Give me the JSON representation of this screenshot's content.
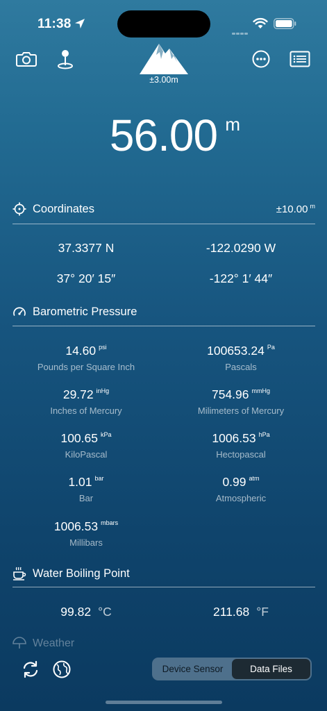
{
  "status": {
    "time": "11:38"
  },
  "header": {
    "accuracy": "±3.00m"
  },
  "altitude": {
    "value": "56.00",
    "unit": "m"
  },
  "coordinates": {
    "title": "Coordinates",
    "accuracy": "±10.00",
    "accuracy_unit": "m",
    "lat_decimal": "37.3377 N",
    "lon_decimal": "-122.0290 W",
    "lat_dms": "37° 20′ 15″",
    "lon_dms": "-122° 1′ 44″"
  },
  "pressure": {
    "title": "Barometric Pressure",
    "items": [
      {
        "value": "14.60",
        "unit": "psi",
        "label": "Pounds per Square Inch"
      },
      {
        "value": "100653.24",
        "unit": "Pa",
        "label": "Pascals"
      },
      {
        "value": "29.72",
        "unit": "inHg",
        "label": "Inches of Mercury"
      },
      {
        "value": "754.96",
        "unit": "mmHg",
        "label": "Milimeters of Mercury"
      },
      {
        "value": "100.65",
        "unit": "kPa",
        "label": "KiloPascal"
      },
      {
        "value": "1006.53",
        "unit": "hPa",
        "label": "Hectopascal"
      },
      {
        "value": "1.01",
        "unit": "bar",
        "label": "Bar"
      },
      {
        "value": "0.99",
        "unit": "atm",
        "label": "Atmospheric"
      },
      {
        "value": "1006.53",
        "unit": "mbars",
        "label": "Millibars"
      }
    ]
  },
  "boiling": {
    "title": "Water Boiling Point",
    "celsius": "99.82",
    "celsius_unit": "°C",
    "fahrenheit": "211.68",
    "fahrenheit_unit": "°F"
  },
  "weather": {
    "title": "Weather"
  },
  "segmented": {
    "device_sensor": "Device Sensor",
    "data_files": "Data Files",
    "selected": "Data Files"
  }
}
